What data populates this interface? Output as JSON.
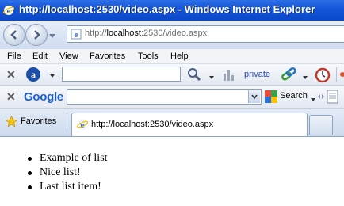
{
  "window": {
    "title": "http://localhost:2530/video.aspx - Windows Internet Explorer",
    "icon": "ie-icon",
    "title_color": "#1456d8"
  },
  "address_bar": {
    "url_prefix": "http://",
    "url_host": "localhost",
    "url_rest": ":2530/video.aspx"
  },
  "menu": {
    "items": [
      "File",
      "Edit",
      "View",
      "Favorites",
      "Tools",
      "Help"
    ]
  },
  "toolbar": {
    "private_label": "private"
  },
  "google_toolbar": {
    "logo": "Google",
    "search_label": "Search"
  },
  "tabs": {
    "favorites_label": "Favorites",
    "active_tab_title": "http://localhost:2530/video.aspx"
  },
  "page": {
    "list_items": [
      "Example of list",
      "Nice list!",
      "Last list item!"
    ]
  }
}
